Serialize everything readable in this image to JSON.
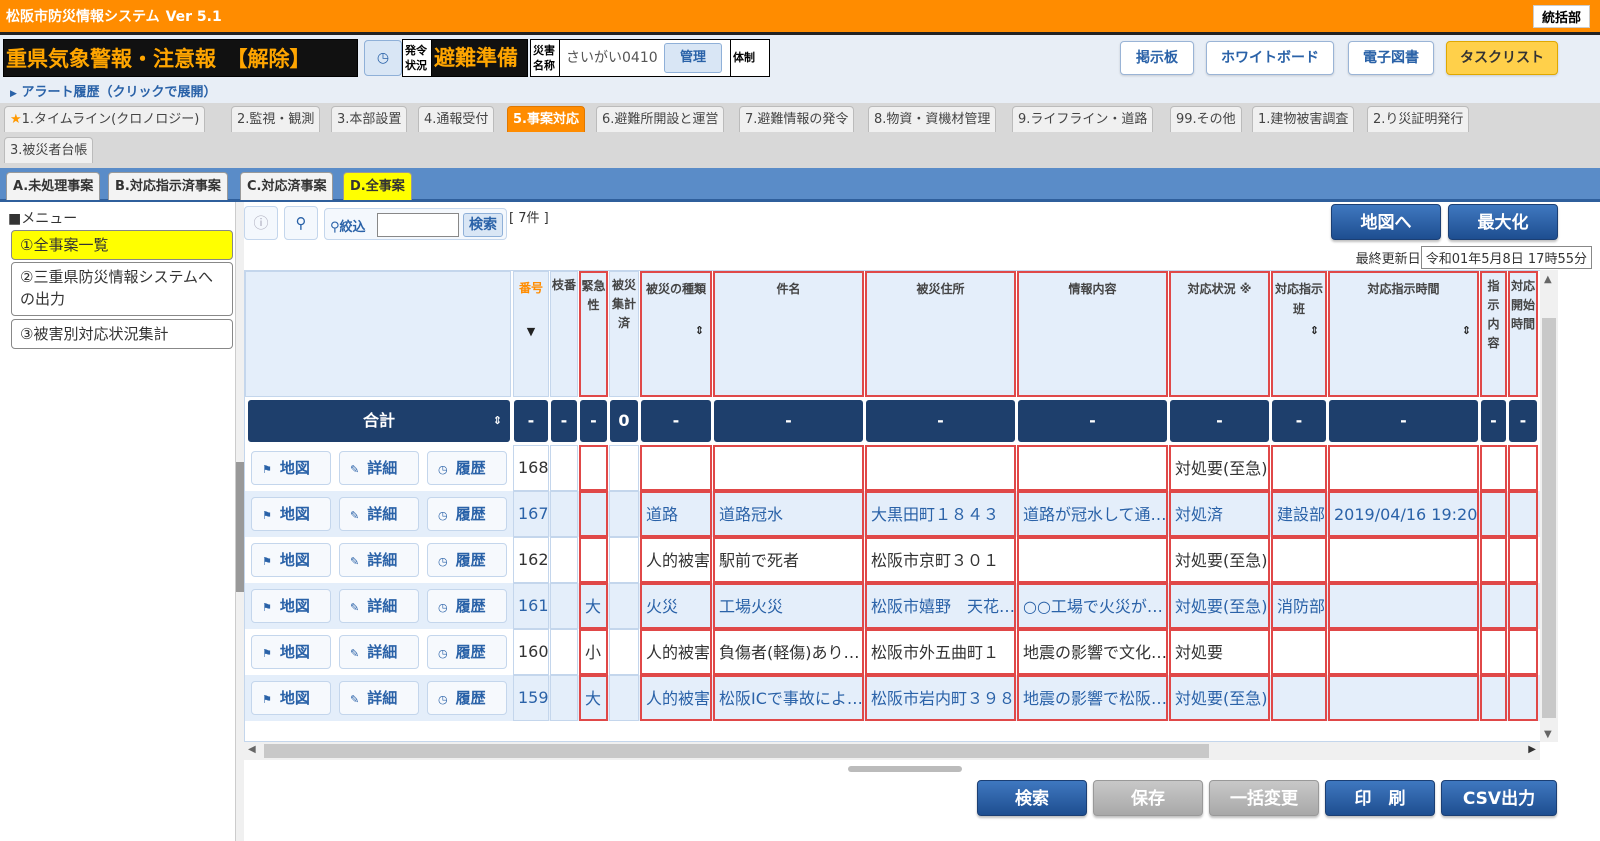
{
  "app": {
    "title": "松阪市防災情報システム",
    "version": "Ver 5.1",
    "department": "統括部"
  },
  "header": {
    "warning_text": "重県気象警報・注意報　【解除】",
    "issue_status_label": "発令状況",
    "issue_status_value": "避難準備",
    "disaster_name_label": "災害名称",
    "disaster_name_value": "さいがい0410",
    "manage_button": "管理",
    "system_label": "体制",
    "buttons": [
      "掲示板",
      "ホワイトボード",
      "電子図書",
      "タスクリスト"
    ]
  },
  "alert_history": "アラート履歴（クリックで展開）",
  "tabs": [
    "1.タイムライン(クロノロジー)",
    "2.監視・観測",
    "3.本部設置",
    "4.通報受付",
    "5.事案対応",
    "6.避難所開設と運営",
    "7.避難情報の発令",
    "8.物資・資機材管理",
    "9.ライフライン・道路",
    "99.その他",
    "1.建物被害調査",
    "2.り災証明発行",
    "3.被災者台帳"
  ],
  "active_tab": "5.事案対応",
  "subtabs": [
    "A.未処理事案",
    "B.対応指示済事案",
    "C.対応済事案",
    "D.全事案"
  ],
  "menu": {
    "title": "■メニュー",
    "items": [
      "①全事案一覧",
      "②三重県防災情報システムへの出力",
      "③被害別対応状況集計"
    ]
  },
  "toolbar": {
    "filter_label": "絞込",
    "filter_value": "",
    "search_button": "検索",
    "count": "[ 7件 ]",
    "map_button": "地図へ",
    "maximize_button": "最大化",
    "last_updated_label": "最終更新日",
    "last_updated_value": "令和01年5月8日 17時55分"
  },
  "table": {
    "headers": {
      "number": "番号",
      "branch": "枝番",
      "urgency": "緊急性",
      "aggregated": "被災集計済",
      "disaster_type": "被災の種類",
      "subject": "件名",
      "address": "被災住所",
      "info": "情報内容",
      "status": "対応状況 ※",
      "team": "対応指示班",
      "instruct_time": "対応指示時間",
      "instruct_content": "指示内容",
      "start_time": "対応開始時間"
    },
    "summary": {
      "label": "合計",
      "dash": "-",
      "zero": "0"
    },
    "row_buttons": {
      "map": "地図",
      "detail": "詳細",
      "history": "履歴"
    },
    "rows": [
      {
        "number": "168",
        "urgency": "",
        "type": "",
        "subject": "",
        "address": "",
        "info": "",
        "status": "対処要(至急)",
        "team": "",
        "time": ""
      },
      {
        "number": "167",
        "urgency": "",
        "type": "道路",
        "subject": "道路冠水",
        "address": "大黒田町１８４３",
        "info": "道路が冠水して通…",
        "status": "対処済",
        "team": "建設部",
        "time": "2019/04/16 19:20"
      },
      {
        "number": "162",
        "urgency": "",
        "type": "人的被害",
        "subject": "駅前で死者",
        "address": "松阪市京町３０１",
        "info": "",
        "status": "対処要(至急)",
        "team": "",
        "time": ""
      },
      {
        "number": "161",
        "urgency": "大",
        "type": "火災",
        "subject": "工場火災",
        "address": "松阪市嬉野　天花…",
        "info": "○○工場で火災が…",
        "status": "対処要(至急)",
        "team": "消防部",
        "time": ""
      },
      {
        "number": "160",
        "urgency": "小",
        "type": "人的被害",
        "subject": "負傷者(軽傷)あり…",
        "address": "松阪市外五曲町１",
        "info": "地震の影響で文化…",
        "status": "対処要",
        "team": "",
        "time": ""
      },
      {
        "number": "159",
        "urgency": "大",
        "type": "人的被害",
        "subject": "松阪ICで事故によ…",
        "address": "松阪市岩内町３９８",
        "info": "地震の影響で松阪…",
        "status": "対処要(至急)",
        "team": "",
        "time": ""
      }
    ]
  },
  "footer_buttons": {
    "search": "検索",
    "save": "保存",
    "bulk": "一括変更",
    "print": "印　刷",
    "csv": "CSV出力"
  }
}
